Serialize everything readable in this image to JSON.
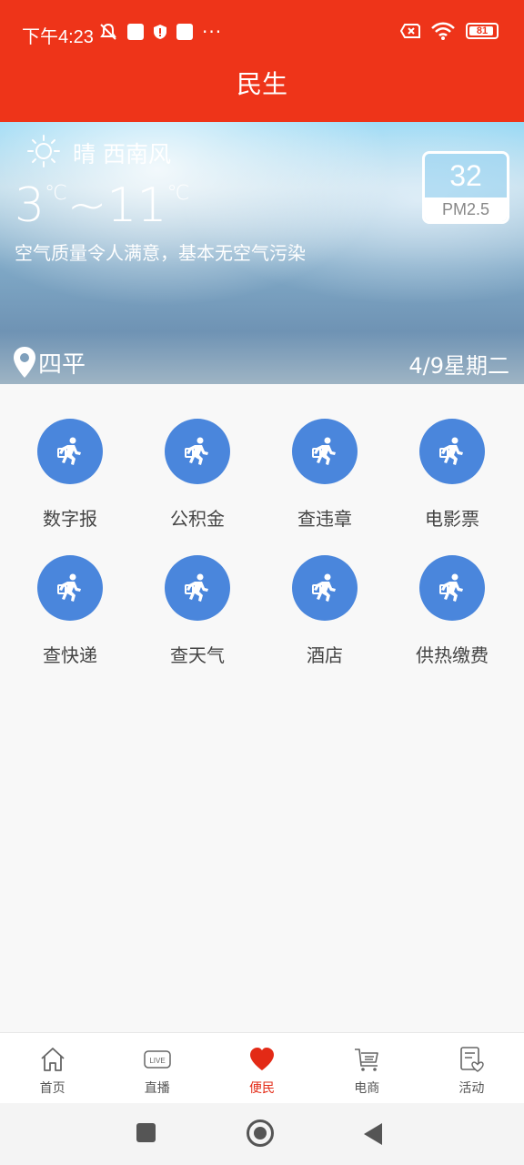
{
  "status_bar": {
    "time": "下午4:23",
    "battery": "81",
    "battery_level": 0.81
  },
  "header": {
    "title": "民生"
  },
  "weather": {
    "condition": "晴 西南风",
    "temp_low": "3",
    "temp_high": "11",
    "unit": "℃",
    "separator": "~",
    "air_quality": "空气质量令人满意，基本无空气污染",
    "pm_value": "32",
    "pm_label": "PM2.5",
    "city": "四平",
    "date": "4/9星期二"
  },
  "services": [
    {
      "label": "数字报",
      "icon": "running-man-icon"
    },
    {
      "label": "公积金",
      "icon": "running-man-icon"
    },
    {
      "label": "查违章",
      "icon": "running-man-icon"
    },
    {
      "label": "电影票",
      "icon": "running-man-icon"
    },
    {
      "label": "查快递",
      "icon": "running-man-icon"
    },
    {
      "label": "查天气",
      "icon": "running-man-icon"
    },
    {
      "label": "酒店",
      "icon": "running-man-icon"
    },
    {
      "label": "供热缴费",
      "icon": "running-man-icon"
    }
  ],
  "tabs": [
    {
      "label": "首页",
      "icon": "home-icon"
    },
    {
      "label": "直播",
      "icon": "live-icon",
      "badge": "LIVE"
    },
    {
      "label": "便民",
      "icon": "heart-icon",
      "active": true
    },
    {
      "label": "电商",
      "icon": "cart-icon"
    },
    {
      "label": "活动",
      "icon": "activity-icon"
    }
  ],
  "colors": {
    "brand": "#ee3419",
    "service_icon_bg": "#4a86dc",
    "active_tab": "#e32a16"
  }
}
